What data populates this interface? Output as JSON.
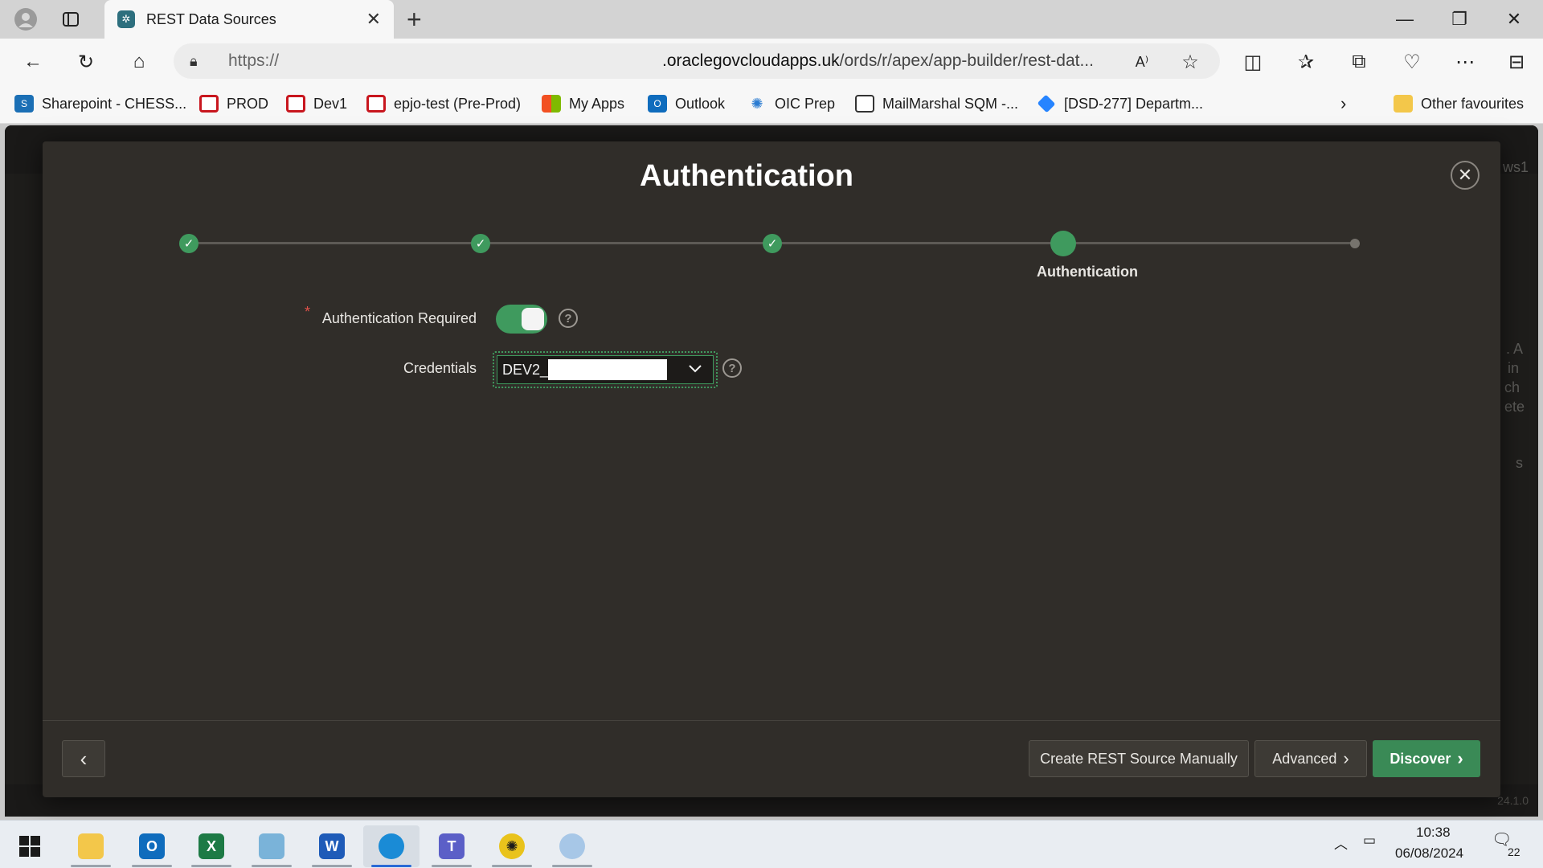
{
  "browser": {
    "tab_title": "REST Data Sources",
    "url_prefix": "https://",
    "url_domain": ".oraclegovcloudapps.uk",
    "url_path": "/ords/r/apex/app-builder/rest-dat...",
    "favourites": [
      {
        "label": "Sharepoint - CHESS...",
        "icon": "sharepoint-icon"
      },
      {
        "label": "PROD",
        "icon": "oracle-icon"
      },
      {
        "label": "Dev1",
        "icon": "oracle-icon"
      },
      {
        "label": "epjo-test (Pre-Prod)",
        "icon": "oracle-icon"
      },
      {
        "label": "My Apps",
        "icon": "microsoft-icon"
      },
      {
        "label": "Outlook",
        "icon": "outlook-icon"
      },
      {
        "label": "OIC Prep",
        "icon": "oic-icon"
      },
      {
        "label": "MailMarshal SQM -...",
        "icon": "document-icon"
      },
      {
        "label": "[DSD-277] Departm...",
        "icon": "jira-icon"
      }
    ],
    "other_favourites": "Other favourites"
  },
  "modal": {
    "title": "Authentication",
    "close_glyph": "✕",
    "wizard": {
      "current_label": "Authentication",
      "check_glyph": "✓"
    },
    "fields": {
      "auth_required_label": "Authentication Required",
      "auth_required_value": true,
      "credentials_label": "Credentials",
      "credentials_value": "DEV2_"
    },
    "footer": {
      "back_glyph": "‹",
      "create_manually": "Create REST Source Manually",
      "advanced": "Advanced",
      "discover": "Discover"
    }
  },
  "background_page": {
    "right_text": [
      "ws1",
      ". A",
      "in",
      "ch",
      "ete",
      "s"
    ],
    "version": "24.1.0"
  },
  "taskbar": {
    "time": "10:38",
    "date": "06/08/2024",
    "notifications": "22"
  },
  "colors": {
    "accent_green": "#3f9a5e",
    "modal_bg": "#302d29",
    "required_star": "#e0524a"
  }
}
